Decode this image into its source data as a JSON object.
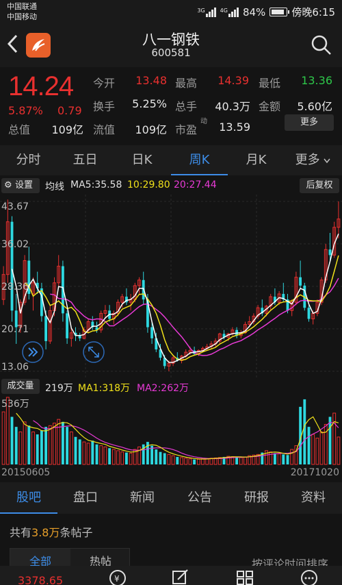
{
  "status": {
    "carrier1": "中国联通",
    "carrier2": "中国移动",
    "sig1_tag": "3G",
    "sig2_tag": "4G",
    "battery": "84%",
    "time": "傍晚6:15"
  },
  "header": {
    "name": "八一钢铁",
    "code": "600581"
  },
  "quote": {
    "price": "14.24",
    "change_pct": "5.87%",
    "change": "0.79",
    "fields": {
      "open_label": "今开",
      "open": "13.48",
      "high_label": "最高",
      "high": "14.39",
      "low_label": "最低",
      "low": "13.36",
      "turnover_label": "换手",
      "turnover": "5.25%",
      "volume_label": "总手",
      "volume": "40.3万",
      "amount_label": "金额",
      "amount": "5.60亿",
      "mktcap_label": "总值",
      "mktcap": "109亿",
      "float_label": "流值",
      "float": "109亿",
      "pe_label": "市盈",
      "pe_mark": "动",
      "pe": "13.59"
    },
    "more_label": "更多"
  },
  "chart_tabs": [
    "分时",
    "五日",
    "日K",
    "周K",
    "月K",
    "更多"
  ],
  "active_chart_tab": "周K",
  "ma_bar": {
    "settings": "设置",
    "label": "均线",
    "ma5": "MA5:35.58",
    "ma10": "10:29.80",
    "ma20": "20:27.44",
    "fq": "后复权"
  },
  "price_axis": [
    "43.67",
    "36.02",
    "28.36",
    "20.71",
    "13.06"
  ],
  "volume_bar": {
    "label": "成交量",
    "value": "219万",
    "ma1": "MA1:318万",
    "ma2": "MA2:262万",
    "axis_max": "536万"
  },
  "dates": {
    "start": "20150605",
    "end": "20171020"
  },
  "bottom_tabs": [
    "股吧",
    "盘口",
    "新闻",
    "公告",
    "研报",
    "资料"
  ],
  "active_bottom_tab": "股吧",
  "posts": {
    "prefix": "共有",
    "count": "3.8万",
    "suffix": "条帖子",
    "seg_all": "全部",
    "seg_hot": "热帖",
    "sort": "按评论时间排序"
  },
  "footer": {
    "price": "3378.65"
  },
  "colors": {
    "up": "#e8302f",
    "down": "#2ec84a",
    "accent": "#3d8de8",
    "ma5": "#ffffff",
    "ma10": "#f0e11a",
    "ma20": "#e83ad6",
    "cyan": "#2ed8e0"
  },
  "chart_data": {
    "type": "candlestick",
    "title": "",
    "y_ticks": [
      43.67,
      36.02,
      28.36,
      20.71,
      13.06
    ],
    "ylim": [
      13.06,
      43.67
    ],
    "x_range": [
      "20150605",
      "20171020"
    ],
    "ohlc": [
      [
        26.0,
        32.0,
        25.0,
        30.5
      ],
      [
        30.5,
        44.0,
        29.0,
        40.0
      ],
      [
        40.0,
        41.0,
        22.0,
        24.0
      ],
      [
        24.0,
        27.0,
        18.0,
        21.0
      ],
      [
        21.0,
        26.0,
        20.0,
        25.5
      ],
      [
        25.5,
        34.0,
        25.0,
        33.0
      ],
      [
        33.0,
        35.5,
        26.0,
        27.0
      ],
      [
        27.0,
        30.0,
        24.0,
        29.0
      ],
      [
        29.0,
        31.0,
        27.0,
        28.0
      ],
      [
        28.0,
        29.0,
        22.0,
        23.0
      ],
      [
        23.0,
        24.0,
        17.0,
        18.5
      ],
      [
        18.5,
        25.0,
        18.0,
        24.0
      ],
      [
        24.0,
        30.0,
        23.0,
        29.0
      ],
      [
        29.0,
        34.0,
        28.0,
        32.0
      ],
      [
        32.0,
        33.0,
        22.0,
        23.5
      ],
      [
        23.5,
        24.0,
        18.0,
        19.0
      ],
      [
        19.0,
        21.0,
        17.5,
        20.0
      ],
      [
        20.0,
        21.0,
        18.5,
        19.5
      ],
      [
        19.5,
        20.0,
        18.5,
        19.0
      ],
      [
        19.0,
        21.0,
        18.8,
        20.5
      ],
      [
        20.5,
        22.5,
        20.0,
        22.0
      ],
      [
        22.0,
        23.0,
        20.5,
        21.0
      ],
      [
        21.0,
        22.0,
        20.0,
        20.5
      ],
      [
        20.5,
        24.0,
        20.0,
        23.5
      ],
      [
        23.5,
        25.0,
        22.5,
        24.0
      ],
      [
        24.0,
        25.0,
        22.0,
        22.5
      ],
      [
        22.5,
        24.0,
        21.5,
        23.5
      ],
      [
        23.5,
        26.0,
        23.0,
        25.5
      ],
      [
        25.5,
        27.0,
        24.5,
        26.5
      ],
      [
        26.5,
        28.0,
        25.0,
        25.5
      ],
      [
        25.5,
        27.0,
        24.0,
        26.0
      ],
      [
        26.0,
        29.0,
        25.5,
        28.5
      ],
      [
        28.5,
        30.0,
        27.0,
        29.5
      ],
      [
        29.5,
        31.0,
        25.0,
        26.0
      ],
      [
        26.0,
        27.0,
        20.0,
        21.0
      ],
      [
        21.0,
        22.0,
        18.0,
        19.0
      ],
      [
        19.0,
        20.0,
        16.5,
        17.0
      ],
      [
        17.0,
        18.0,
        15.0,
        15.5
      ],
      [
        15.5,
        16.0,
        13.5,
        14.0
      ],
      [
        14.0,
        15.0,
        13.06,
        14.5
      ],
      [
        14.5,
        16.0,
        14.0,
        15.5
      ],
      [
        15.5,
        16.5,
        14.8,
        15.0
      ],
      [
        15.0,
        16.0,
        14.5,
        15.8
      ],
      [
        15.8,
        17.0,
        15.5,
        16.5
      ],
      [
        16.5,
        17.5,
        16.0,
        16.8
      ],
      [
        16.8,
        17.5,
        16.0,
        16.2
      ],
      [
        16.2,
        17.0,
        15.8,
        16.8
      ],
      [
        16.8,
        17.5,
        16.5,
        17.2
      ],
      [
        17.2,
        18.0,
        16.8,
        17.5
      ],
      [
        17.5,
        18.5,
        17.0,
        18.0
      ],
      [
        18.0,
        19.0,
        17.5,
        18.5
      ],
      [
        18.5,
        20.0,
        18.0,
        19.8
      ],
      [
        19.8,
        20.5,
        18.8,
        19.2
      ],
      [
        19.2,
        20.0,
        18.5,
        19.8
      ],
      [
        19.8,
        21.0,
        19.5,
        20.5
      ],
      [
        20.5,
        21.0,
        19.0,
        19.5
      ],
      [
        19.5,
        20.5,
        19.0,
        20.0
      ],
      [
        20.0,
        22.0,
        19.8,
        21.5
      ],
      [
        21.5,
        23.0,
        21.0,
        22.0
      ],
      [
        22.0,
        23.5,
        21.5,
        23.0
      ],
      [
        23.0,
        25.0,
        22.5,
        24.5
      ],
      [
        24.5,
        26.0,
        23.0,
        23.5
      ],
      [
        23.5,
        25.0,
        23.0,
        24.8
      ],
      [
        24.8,
        27.0,
        24.0,
        26.5
      ],
      [
        26.5,
        28.0,
        25.0,
        25.5
      ],
      [
        25.5,
        27.5,
        25.0,
        27.0
      ],
      [
        27.0,
        29.0,
        25.5,
        26.0
      ],
      [
        26.0,
        27.0,
        23.5,
        24.0
      ],
      [
        24.0,
        26.0,
        23.0,
        25.5
      ],
      [
        25.5,
        31.0,
        25.0,
        30.0
      ],
      [
        30.0,
        33.0,
        28.0,
        28.5
      ],
      [
        28.5,
        29.0,
        24.0,
        24.5
      ],
      [
        24.5,
        25.0,
        22.0,
        22.5
      ],
      [
        22.5,
        24.0,
        21.5,
        23.5
      ],
      [
        23.5,
        26.0,
        23.0,
        25.5
      ],
      [
        25.5,
        30.0,
        25.0,
        29.5
      ],
      [
        29.5,
        36.0,
        29.0,
        35.0
      ],
      [
        35.0,
        38.0,
        33.0,
        34.0
      ],
      [
        34.0,
        40.0,
        33.5,
        39.0
      ],
      [
        39.0,
        43.67,
        37.0,
        40.5
      ]
    ],
    "volume": [
      420,
      536,
      380,
      300,
      260,
      340,
      310,
      260,
      240,
      270,
      300,
      310,
      330,
      360,
      340,
      300,
      260,
      220,
      200,
      180,
      170,
      190,
      160,
      150,
      140,
      130,
      120,
      110,
      100,
      95,
      90,
      120,
      140,
      160,
      180,
      150,
      120,
      100,
      90,
      80,
      70,
      60,
      55,
      50,
      45,
      40,
      42,
      45,
      48,
      50,
      52,
      55,
      60,
      65,
      62,
      58,
      55,
      60,
      70,
      75,
      80,
      95,
      110,
      100,
      90,
      85,
      80,
      75,
      120,
      150,
      460,
      520,
      300,
      240,
      210,
      260,
      320,
      380,
      410,
      219
    ],
    "ma5_series_note": "",
    "legend": [
      "MA5",
      "MA10",
      "MA20"
    ]
  }
}
